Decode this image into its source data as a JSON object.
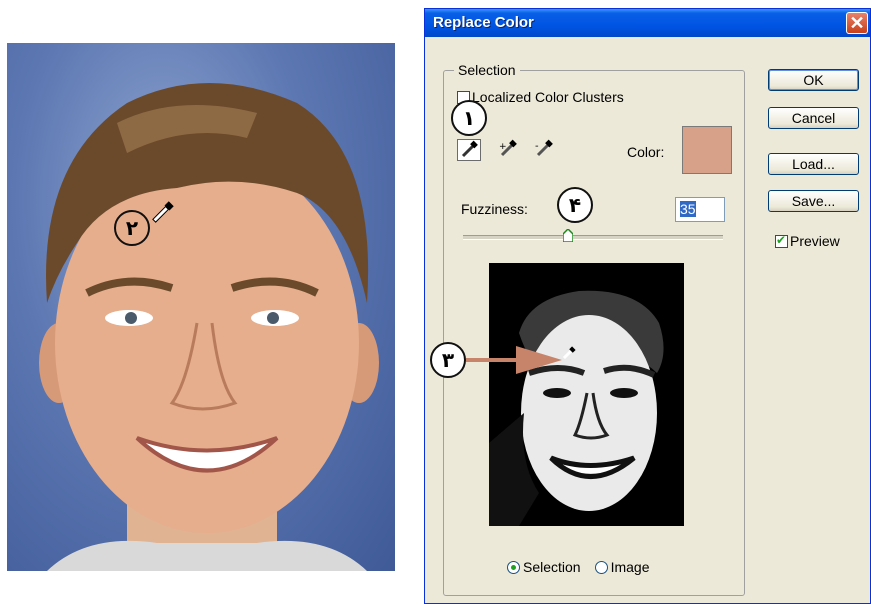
{
  "dialog": {
    "title": "Replace Color",
    "close_glyph": "✕",
    "selection_group_label": "Selection",
    "localized_label": "Localized Color Clusters",
    "color_label": "Color:",
    "color_swatch": "#d7a088",
    "fuzziness_label": "Fuzziness:",
    "fuzziness_value": "35",
    "fuzziness_level": 0.35,
    "radio_selection_label": "Selection",
    "radio_image_label": "Image",
    "radio_selected": "Selection",
    "buttons": {
      "ok": "OK",
      "cancel": "Cancel",
      "load": "Load...",
      "save": "Save..."
    },
    "preview_label": "Preview",
    "preview_checked": true,
    "localized_checked": false
  },
  "eyedroppers": [
    "eyedropper-icon",
    "eyedropper-plus-icon",
    "eyedropper-minus-icon"
  ],
  "annotations": {
    "n1": "۱",
    "n2": "۲",
    "n3": "۳",
    "n4": "۴"
  },
  "colors": {
    "titlebar": "#0054e3",
    "dialog_bg": "#ece9d8",
    "arrow": "#c8846a",
    "photo_bg": "#5c77b2"
  }
}
